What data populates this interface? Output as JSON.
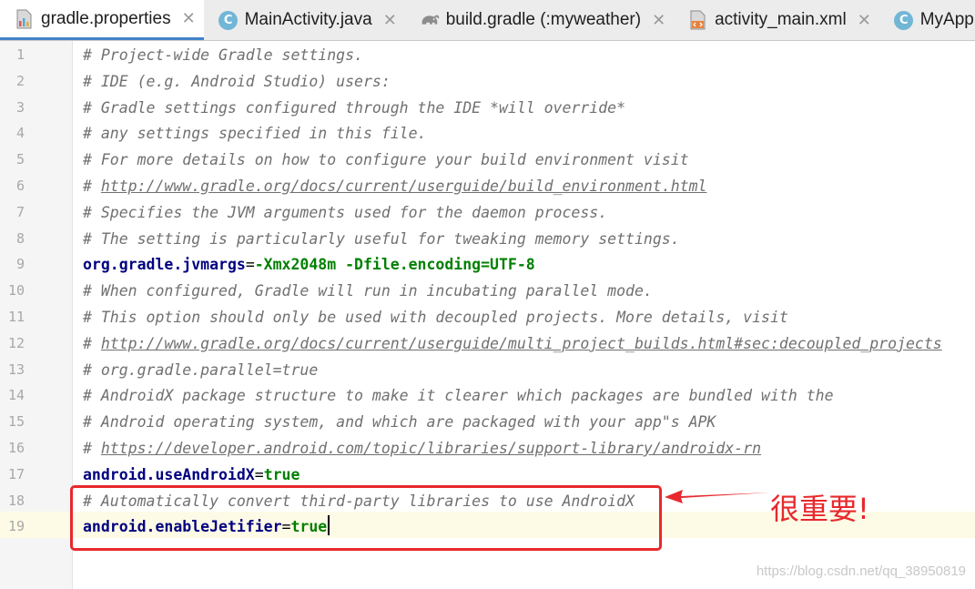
{
  "tabs": [
    {
      "label": "gradle.properties",
      "icon": "gradle-properties-file-icon",
      "active": true
    },
    {
      "label": "MainActivity.java",
      "icon": "java-class-c-icon",
      "active": false
    },
    {
      "label": "build.gradle (:myweather)",
      "icon": "gradle-elephant-icon",
      "active": false
    },
    {
      "label": "activity_main.xml",
      "icon": "xml-layout-file-icon",
      "active": false
    },
    {
      "label": "MyApplicat",
      "icon": "java-class-c-icon",
      "active": false
    }
  ],
  "close_glyph": "✕",
  "class_glyph": "C",
  "editor": {
    "lines": [
      {
        "num": "1",
        "text": "# Project-wide Gradle settings."
      },
      {
        "num": "2",
        "text": "# IDE (e.g. Android Studio) users:"
      },
      {
        "num": "3",
        "text": "# Gradle settings configured through the IDE *will override*"
      },
      {
        "num": "4",
        "text": "# any settings specified in this file."
      },
      {
        "num": "5",
        "text": "# For more details on how to configure your build environment visit"
      },
      {
        "num": "6",
        "text": "# ",
        "link": "http://www.gradle.org/docs/current/userguide/build_environment.html"
      },
      {
        "num": "7",
        "text": "# Specifies the JVM arguments used for the daemon process."
      },
      {
        "num": "8",
        "text": "# The setting is particularly useful for tweaking memory settings."
      },
      {
        "num": "9",
        "key": "org.gradle.jvmargs",
        "value": "-Xmx2048m -Dfile.encoding=UTF-8"
      },
      {
        "num": "10",
        "text": "# When configured, Gradle will run in incubating parallel mode."
      },
      {
        "num": "11",
        "text": "# This option should only be used with decoupled projects. More details, visit"
      },
      {
        "num": "12",
        "text": "# ",
        "link": "http://www.gradle.org/docs/current/userguide/multi_project_builds.html#sec:decoupled_projects"
      },
      {
        "num": "13",
        "text": "# org.gradle.parallel=true"
      },
      {
        "num": "14",
        "text": "# AndroidX package structure to make it clearer which packages are bundled with the"
      },
      {
        "num": "15",
        "text": "# Android operating system, and which are packaged with your app\"s APK"
      },
      {
        "num": "16",
        "text": "# ",
        "link": "https://developer.android.com/topic/libraries/support-library/androidx-rn"
      },
      {
        "num": "17",
        "key": "android.useAndroidX",
        "value": "true"
      },
      {
        "num": "18",
        "text": "# Automatically convert third-party libraries to use AndroidX"
      },
      {
        "num": "19",
        "key": "android.enableJetifier",
        "value": "true"
      }
    ]
  },
  "annotation": {
    "note": "很重要!",
    "color": "#e8282d"
  },
  "watermark": "https://blog.csdn.net/qq_38950819"
}
